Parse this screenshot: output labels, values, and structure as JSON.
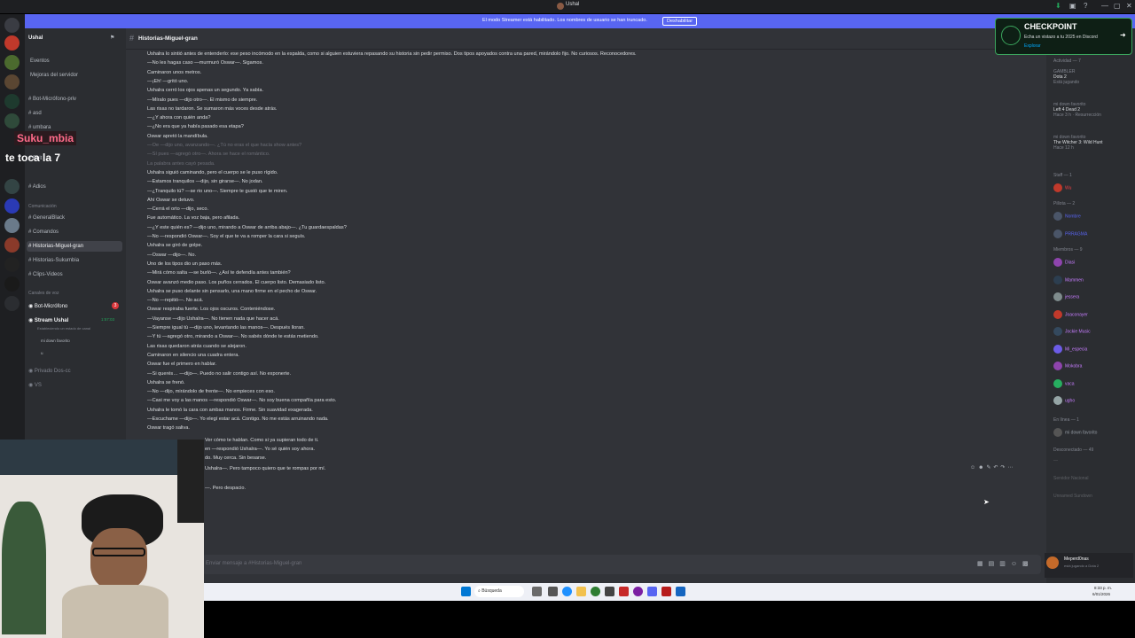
{
  "window": {
    "title": "Ushal",
    "controls": [
      "—",
      "▢",
      "✕"
    ]
  },
  "banner": {
    "text": "El modo Streamer está habilitado. Los nombres de usuario se han truncado.",
    "button": "Deshabilitar"
  },
  "server": {
    "name": "Ushal"
  },
  "sidebar": {
    "top_items": [
      "Eventos",
      "Mejoras del servidor"
    ],
    "channels_a": [
      "Bot-Micrófono-priv",
      "asd",
      "umbara",
      "ll-ab",
      "Bolt",
      "Adios"
    ],
    "category_comunicacion": "Comunicación",
    "channels_b": [
      "GeneralBlack",
      "Comandos",
      "Historias-Miguel-gran",
      "Historias-Sukumbia",
      "Clips-Videos"
    ],
    "category_voz": "Canales de voz",
    "voice": [
      "Bot-Micrófono",
      "Stream Ushal"
    ],
    "voice_sub": [
      "Ushal",
      "mi down favorito",
      "u"
    ],
    "voice_time": "1:57:03",
    "voice_extra": [
      "Privado Dos-cc",
      "VS"
    ],
    "voice_sub_text": "Estableciendo un estado de canal",
    "badge": "3"
  },
  "channel": {
    "name": "Historias-Miguel-gran",
    "input_placeholder": "Enviar mensaje a #Historias-Miguel-gran"
  },
  "messages": [
    "Ushalra lo sintió antes de entenderlo: ese peso incómodo en la espalda, como si alguien estuviera repasando su historia sin pedir permiso. Dos tipos apoyados contra una pared, mirándolo fijo. No curiosos. Reconocedores.",
    "—No les hagas caso —murmuró Oswar—. Sigamos.",
    "Caminaron unos metros.",
    "—¡Eh! —gritó uno.",
    "Ushalra cerró los ojos apenas un segundo. Ya sabía.",
    "—Míralo pues —dijo otro—. El mismo de siempre.",
    "Las risas no tardaron. Se sumaron más voces desde atrás.",
    "—¿Y ahora con quién anda?",
    "—¿No era que ya había pasado esa etapa?",
    "Oswar apretó la mandíbula.",
    "—Oe —dijo uno, avanzando—. ¿Tú no eras el que hacía show antes?",
    "—Sí pues —agregó otro—. Ahora se hace el romántico.",
    "La palabra antes cayó pesada.",
    "Ushalra siguió caminando, pero el cuerpo se le puso rígido.",
    "—Estamos tranquilos —dijo, sin girarse—. No jodan.",
    "—¿Tranquilo tú? —se rio uno—. Siempre te gustó que te miren.",
    "Ahí Oswar se detuvo.",
    "—Cerrá el orto —dijo, seco.",
    "Fue automático. La voz baja, pero afilada.",
    "—¿Y este quién es? —dijo uno, mirando a Oswar de arriba abajo—. ¿Tu guardaespaldas?",
    "—No —respondió Oswar—. Soy el que te va a romper la cara si seguís.",
    "Ushalra se giró de golpe.",
    "—Oswar —dijo—. No.",
    "Uno de los tipos dio un paso más.",
    "—Mirá cómo salta —se burló—. ¿Así te defendía antes también?",
    "Oswar avanzó medio paso. Los puños cerrados. El cuerpo listo. Demasiado listo.",
    "Ushalra se puso delante sin pensarlo, una mano firme en el pecho de Oswar.",
    "—No —repitió—. No acá.",
    "Oswar respiraba fuerte. Los ojos oscuros. Conteniéndose.",
    "—Vayanse —dijo Ushalra—. No tienen nada que hacer acá.",
    "—Siempre igual tú —dijo uno, levantando las manos—. Después lloran.",
    "—Y tú —agregó otro, mirando a Oswar—. No sabés dónde te estás metiendo.",
    "Las risas quedaron atrás cuando se alejaron.",
    "Caminaron en silencio una cuadra entera.",
    "Oswar fue el primero en hablar.",
    "—Si querés… —dijo—. Puedo no salir contigo así. No exponerte.",
    "Ushalra se frenó.",
    "—No —dijo, mirándolo de frente—. No empieces con eso.",
    "—Casi me voy a las manos —respondió Oswar—. No soy buena compañía para esto.",
    "Ushalra le tomó la cara con ambas manos. Firme. Sin suavidad exagerada.",
    "—Escuchame —dijo—. Yo elegí estar acá. Contigo. No me estás arruinando nada.",
    "Oswar tragó saliva.",
    "Ver cómo te hablan. Como si ya supieran todo de ti.",
    "en —respondió Ushalra—. Yo sé quién soy ahora.",
    "do. Muy cerca. Sin besarse.",
    "Ushalra—. Pero tampoco quiero que te rompas por mí.",
    "—. Pero despacio."
  ],
  "members": {
    "activity_header": "Actividad — 7",
    "activities": [
      {
        "name": "GAMBLER",
        "game": "Dota 2",
        "sub": "Está jugando"
      },
      {
        "name": "mi down favorito",
        "game": "Left 4 Dead 2",
        "sub": "Hace 3 h · Resurrección"
      },
      {
        "name": "mi down favorito",
        "game": "The Witcher 3: Wild Hunt",
        "sub": "Hace 12 h"
      }
    ],
    "staff_header": "Staff — 1",
    "staff": [
      {
        "name": "Wu",
        "sub": "En canal de voz"
      }
    ],
    "pillota_header": "Pillota — 2",
    "pillota": [
      {
        "name": "Nombre",
        "tag": "APP",
        "sub": "Help"
      },
      {
        "name": "PRRAGMA",
        "sub": ""
      }
    ],
    "miembros_header": "Miembros — 9",
    "miembros": [
      {
        "name": "Diasi",
        "sub": "Roblox"
      },
      {
        "name": "Mammen",
        "tag": "WOLF",
        "sub": ""
      },
      {
        "name": "jessera",
        "sub": ""
      },
      {
        "name": "Joaconayer",
        "tag": "SAB",
        "sub": ""
      },
      {
        "name": "Jockie Music",
        "tag": "APP",
        "sub": "Ayuda"
      },
      {
        "name": "Mi_especia",
        "sub": "Left 4 Dead 2"
      },
      {
        "name": "Mokobra",
        "tag": "APP",
        "sub": "Ayuda - mokobra.com"
      },
      {
        "name": "vaca",
        "sub": "m. bno"
      },
      {
        "name": "ugho",
        "sub": ""
      }
    ],
    "linea_header": "En línea — 1",
    "linea": [
      {
        "name": "mi down favorito",
        "sub": "En canal de voz"
      }
    ],
    "desconectado_header": "Desconectado — 49",
    "desconectado": [
      "—",
      "Servidor Nacional",
      "Unnamed Sundown"
    ]
  },
  "user_panel": {
    "name": "Meperd0nas",
    "status": "está jugando a Dota 2"
  },
  "checkpoint": {
    "title": "CHECKPOINT",
    "text": "Echa un vistazo a tu 2025 en Discord",
    "link": "Explorar"
  },
  "overlay": {
    "name": "Suku_mbia",
    "text": "te toca la 7"
  },
  "taskbar": {
    "search": "Búsqueda",
    "time": "8:33 p. m.",
    "date": "6/01/2026"
  },
  "colors": {
    "brand": "#5865f2",
    "bg_chat": "#313338",
    "bg_sidebar": "#2b2d31",
    "bg_rail": "#1e1f22",
    "online": "#23a55a"
  }
}
